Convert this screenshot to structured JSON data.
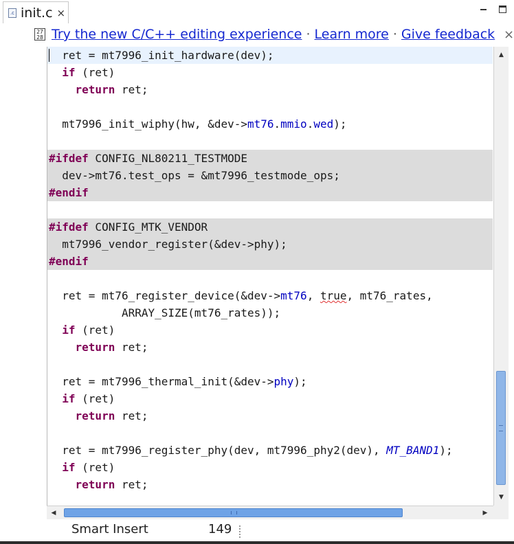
{
  "tab": {
    "title": "init.c",
    "icon": "c-source-file-icon",
    "close_glyph": "×"
  },
  "window": {
    "minimize": "minimize-icon",
    "maximize": "maximize-icon"
  },
  "notification": {
    "icon_glyph": "27\n28",
    "link_try": "Try the new C/C++ editing experience",
    "separator": "·",
    "link_learn": "Learn more",
    "link_feedback": "Give feedback",
    "close_glyph": "×"
  },
  "colors": {
    "keyword": "#7f0055",
    "field": "#0000c0",
    "inactive_bg": "#dcdcdc",
    "current_line_bg": "#e8f2fe",
    "link": "#1528d0",
    "scroll_thumb": "#6fa3e6"
  },
  "code": {
    "lines": [
      {
        "state": "current",
        "parts": [
          [
            "t",
            "ret = mt7996_init_hardware(dev);"
          ]
        ]
      },
      {
        "state": "",
        "parts": [
          [
            "kw",
            "if"
          ],
          [
            "t",
            " (ret)"
          ]
        ]
      },
      {
        "state": "",
        "parts": [
          [
            "t",
            "  "
          ],
          [
            "kw",
            "return"
          ],
          [
            "t",
            " ret;"
          ]
        ]
      },
      {
        "state": "",
        "parts": []
      },
      {
        "state": "",
        "parts": [
          [
            "t",
            "mt7996_init_wiphy(hw, &dev->"
          ],
          [
            "field",
            "mt76"
          ],
          [
            "t",
            "."
          ],
          [
            "field",
            "mmio"
          ],
          [
            "t",
            "."
          ],
          [
            "field",
            "wed"
          ],
          [
            "t",
            ");"
          ]
        ]
      },
      {
        "state": "",
        "parts": []
      },
      {
        "state": "inactive",
        "parts": [
          [
            "kw",
            "#ifdef"
          ],
          [
            "t",
            " CONFIG_NL80211_TESTMODE"
          ]
        ]
      },
      {
        "state": "inactive",
        "parts": [
          [
            "t",
            "  dev->mt76.test_ops = &mt7996_testmode_ops;"
          ]
        ]
      },
      {
        "state": "inactive",
        "parts": [
          [
            "kw",
            "#endif"
          ]
        ]
      },
      {
        "state": "",
        "parts": []
      },
      {
        "state": "inactive",
        "parts": [
          [
            "kw",
            "#ifdef"
          ],
          [
            "t",
            " CONFIG_MTK_VENDOR"
          ]
        ]
      },
      {
        "state": "inactive",
        "parts": [
          [
            "t",
            "  mt7996_vendor_register(&dev->phy);"
          ]
        ]
      },
      {
        "state": "inactive",
        "parts": [
          [
            "kw",
            "#endif"
          ]
        ]
      },
      {
        "state": "",
        "parts": []
      },
      {
        "state": "",
        "parts": [
          [
            "t",
            "  ret = mt76_register_device(&dev->"
          ],
          [
            "field",
            "mt76"
          ],
          [
            "t",
            ", "
          ],
          [
            "sq",
            "true"
          ],
          [
            "t",
            ", mt76_rates,"
          ]
        ]
      },
      {
        "state": "",
        "parts": [
          [
            "t",
            "           ARRAY_SIZE(mt76_rates));"
          ]
        ]
      },
      {
        "state": "",
        "parts": [
          [
            "t",
            "  "
          ],
          [
            "kw",
            "if"
          ],
          [
            "t",
            " (ret)"
          ]
        ]
      },
      {
        "state": "",
        "parts": [
          [
            "t",
            "    "
          ],
          [
            "kw",
            "return"
          ],
          [
            "t",
            " ret;"
          ]
        ]
      },
      {
        "state": "",
        "parts": []
      },
      {
        "state": "",
        "parts": [
          [
            "t",
            "  ret = mt7996_thermal_init(&dev->"
          ],
          [
            "field",
            "phy"
          ],
          [
            "t",
            ");"
          ]
        ]
      },
      {
        "state": "",
        "parts": [
          [
            "t",
            "  "
          ],
          [
            "kw",
            "if"
          ],
          [
            "t",
            " (ret)"
          ]
        ]
      },
      {
        "state": "",
        "parts": [
          [
            "t",
            "    "
          ],
          [
            "kw",
            "return"
          ],
          [
            "t",
            " ret;"
          ]
        ]
      },
      {
        "state": "",
        "parts": []
      },
      {
        "state": "",
        "parts": [
          [
            "t",
            "  ret = mt7996_register_phy(dev, mt7996_phy2(dev), "
          ],
          [
            "enum",
            "MT_BAND1"
          ],
          [
            "t",
            ");"
          ]
        ]
      },
      {
        "state": "",
        "parts": [
          [
            "t",
            "  "
          ],
          [
            "kw",
            "if"
          ],
          [
            "t",
            " (ret)"
          ]
        ]
      },
      {
        "state": "",
        "parts": [
          [
            "t",
            "    "
          ],
          [
            "kw",
            "return"
          ],
          [
            "t",
            " ret;"
          ]
        ]
      },
      {
        "state": "",
        "parts": []
      }
    ]
  },
  "scrollbars": {
    "vertical_position": 0.7,
    "horizontal_position": 0.0
  },
  "status": {
    "insert_mode": "Smart Insert",
    "position": "149"
  }
}
